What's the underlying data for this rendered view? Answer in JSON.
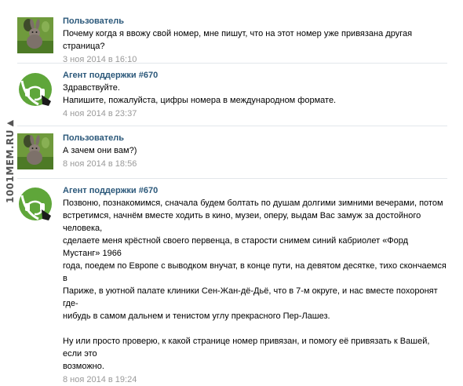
{
  "watermark": "1001MEM.RU",
  "messages": [
    {
      "author": "Пользователь",
      "lines": [
        "Почему когда я ввожу свой номер, мне пишут, что на этот номер уже привязана другая страница?"
      ],
      "date": "3 ноя 2014 в 16:10"
    },
    {
      "author": "Агент поддержки #670",
      "lines": [
        "Здравствуйте.",
        "Напишите, пожалуйста, цифры номера в международном формате."
      ],
      "date": "4 ноя 2014 в 23:37"
    },
    {
      "author": "Пользователь",
      "lines": [
        "А зачем они вам?)"
      ],
      "date": "8 ноя 2014 в 18:56"
    },
    {
      "author": "Агент поддержки #670",
      "paragraph1": [
        "Позвоню, познакомимся, сначала будем болтать по душам долгими зимними вечерами, потом",
        "встретимся, начнём вместе ходить в кино, музеи, оперу, выдам Вас замуж за достойного человека,",
        "сделаете меня крёстной своего первенца, в старости снимем синий кабриолет «Форд Мустанг» 1966",
        "года, поедем по Европе с выводком внучат, в конце пути, на девятом десятке, тихо скончаемся в",
        "Париже, в уютной палате клиники Сен-Жан-дё-Дьё, что в 7-м округе, и нас вместе похоронят где-",
        "нибудь в самом дальнем и тенистом углу прекрасного Пер-Лашез."
      ],
      "paragraph2": [
        "Ну или просто проверю, к какой странице номер привязан, и помогу её привязать к Вашей, если это",
        "возможно."
      ],
      "date": "8 ноя 2014 в 19:24"
    }
  ]
}
